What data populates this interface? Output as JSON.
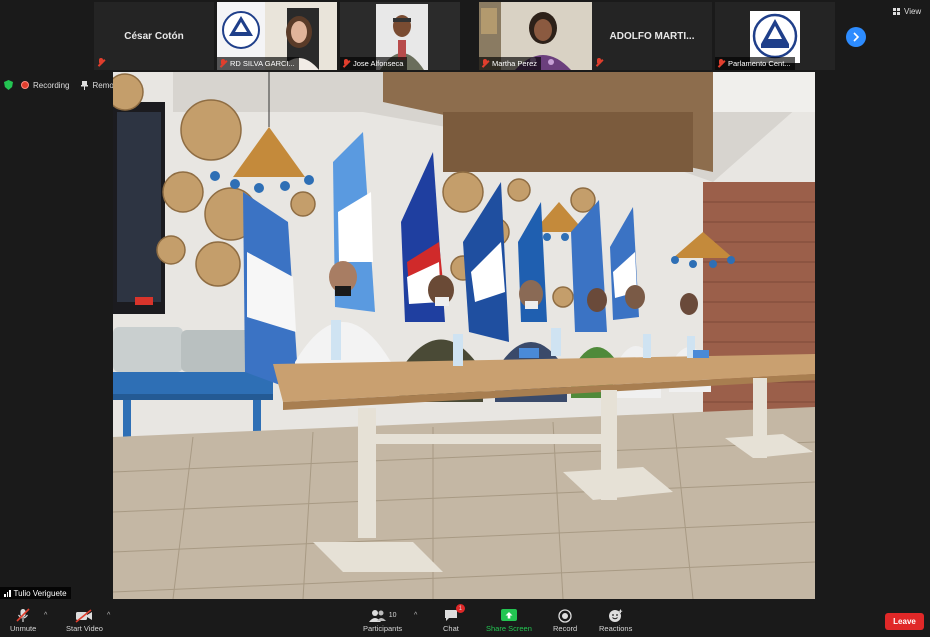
{
  "gallery": {
    "tiles": [
      {
        "name": "César Cotón",
        "type": "name-only"
      },
      {
        "name": "RD SILVA GARCI...",
        "type": "video"
      },
      {
        "name": "Jose Alfonseca",
        "type": "video"
      },
      {
        "name": "Martha Perez",
        "type": "video"
      },
      {
        "name": "ADOLFO MARTI...",
        "type": "name-only"
      },
      {
        "name": "Parlamento Cent...",
        "type": "logo"
      }
    ],
    "logo_text": "PARLAMENTO CENTROAMERICANO",
    "view_label": "View"
  },
  "status": {
    "recording_label": "Recording",
    "remove_pin_label": "Remove Pin"
  },
  "main_video": {
    "speaker_name": "Tulio Veriguete"
  },
  "toolbar": {
    "unmute_label": "Unmute",
    "start_video_label": "Start Video",
    "participants_label": "Participants",
    "participants_count": "10",
    "chat_label": "Chat",
    "chat_badge": "1",
    "share_screen_label": "Share Screen",
    "record_label": "Record",
    "reactions_label": "Reactions",
    "leave_label": "Leave"
  },
  "colors": {
    "zoom_blue": "#2d8cff",
    "share_green": "#23c552",
    "leave_red": "#e02828",
    "mute_red": "#e03e2d"
  }
}
